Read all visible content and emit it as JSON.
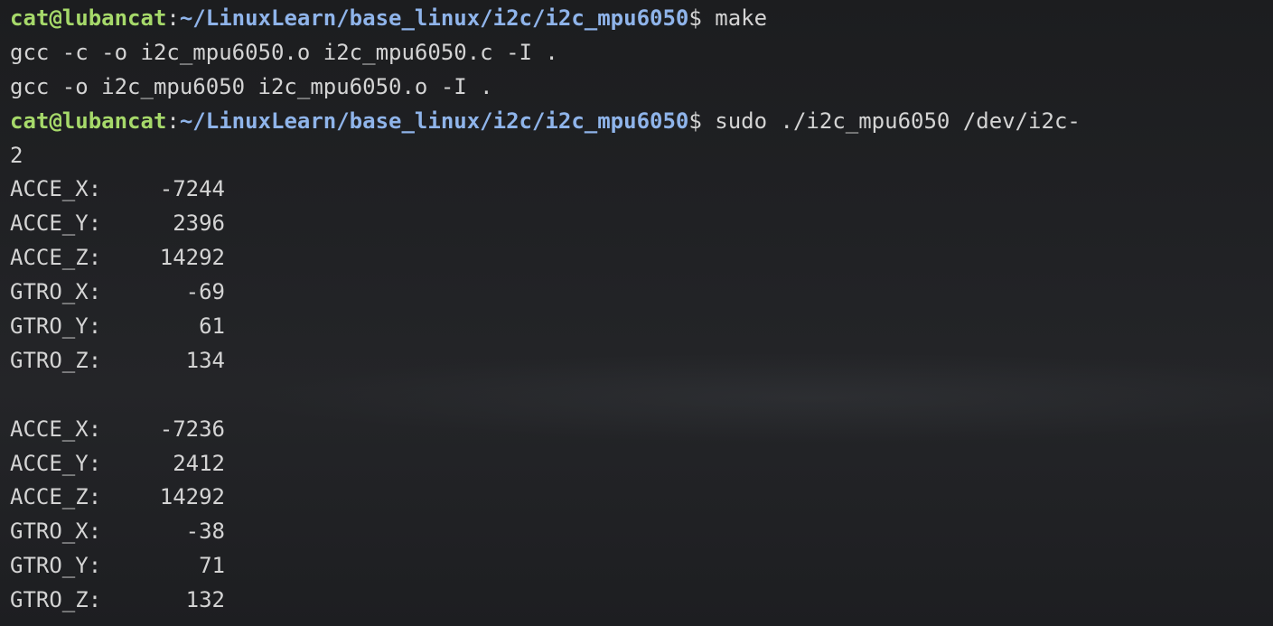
{
  "prompt": {
    "user_host": "cat@lubancat",
    "colon": ":",
    "path": "~/LinuxLearn/base_linux/i2c/i2c_mpu6050",
    "dollar": "$"
  },
  "commands": {
    "make": " make",
    "run": " sudo ./i2c_mpu6050 /dev/i2c-"
  },
  "build_output": [
    "gcc -c -o i2c_mpu6050.o i2c_mpu6050.c -I .",
    "gcc -o i2c_mpu6050 i2c_mpu6050.o -I ."
  ],
  "wrap_continuation": "2",
  "readings": [
    [
      {
        "label": "ACCE_X:",
        "value": "-7244"
      },
      {
        "label": "ACCE_Y:",
        "value": "2396"
      },
      {
        "label": "ACCE_Z:",
        "value": "14292"
      },
      {
        "label": "GTRO_X:",
        "value": "-69"
      },
      {
        "label": "GTRO_Y:",
        "value": "61"
      },
      {
        "label": "GTRO_Z:",
        "value": "134"
      }
    ],
    [
      {
        "label": "ACCE_X:",
        "value": "-7236"
      },
      {
        "label": "ACCE_Y:",
        "value": "2412"
      },
      {
        "label": "ACCE_Z:",
        "value": "14292"
      },
      {
        "label": "GTRO_X:",
        "value": "-38"
      },
      {
        "label": "GTRO_Y:",
        "value": "71"
      },
      {
        "label": "GTRO_Z:",
        "value": "132"
      }
    ]
  ],
  "colors": {
    "background": "#1e1f22",
    "user_host": "#a6d96a",
    "path": "#8fb4ea",
    "text": "#d4d4d4"
  }
}
